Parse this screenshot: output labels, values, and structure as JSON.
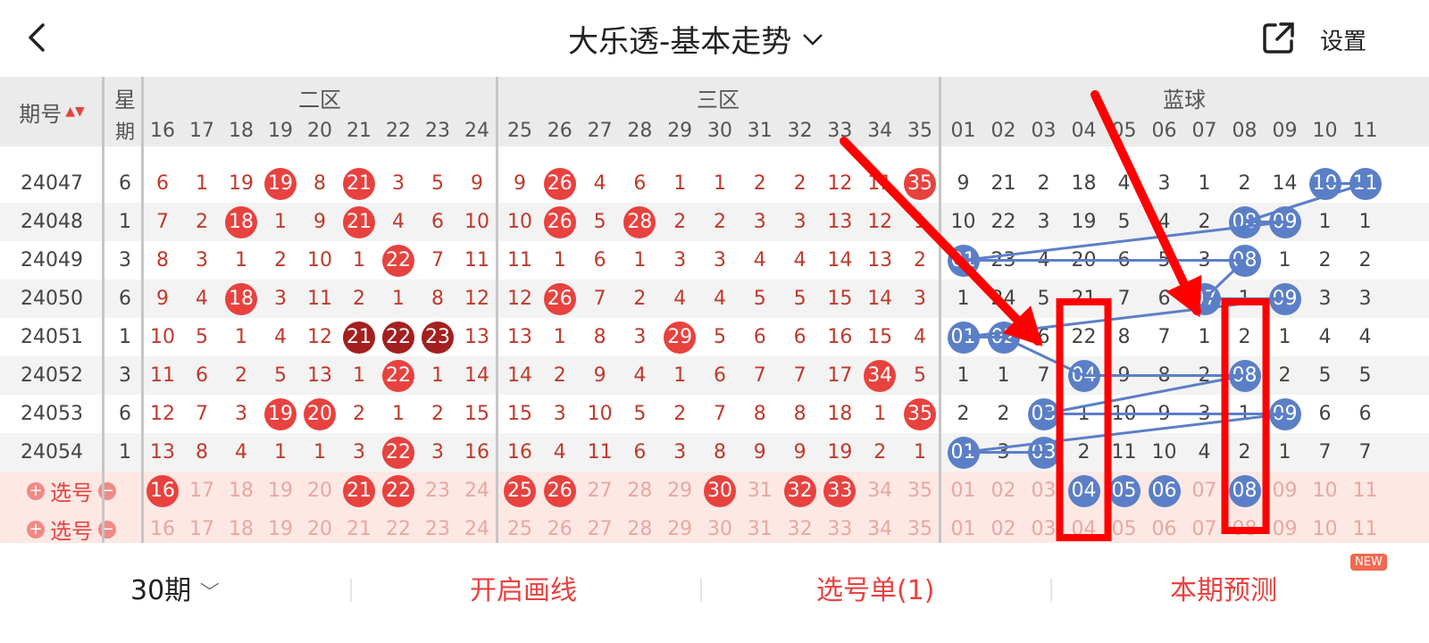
{
  "header": {
    "title": "大乐透-基本走势",
    "settings_label": "设置"
  },
  "table": {
    "issue_header": "期号",
    "week_header": [
      "星",
      "期"
    ],
    "zones": [
      "二区",
      "三区",
      "蓝球"
    ],
    "front_numbers": [
      "16",
      "17",
      "18",
      "19",
      "20",
      "21",
      "22",
      "23",
      "24",
      "25",
      "26",
      "27",
      "28",
      "29",
      "30",
      "31",
      "32",
      "33",
      "34",
      "35"
    ],
    "blue_numbers": [
      "01",
      "02",
      "03",
      "04",
      "05",
      "06",
      "07",
      "08",
      "09",
      "10",
      "11"
    ],
    "rows": [
      {
        "issue": "24047",
        "week": "6",
        "cells": [
          "6",
          "1",
          "19",
          "19",
          "8",
          "21",
          "3",
          "5",
          "9",
          "9",
          "26",
          "4",
          "6",
          "1",
          "1",
          "2",
          "2",
          "12",
          "11",
          "35"
        ],
        "blue": [
          "9",
          "21",
          "2",
          "18",
          "4",
          "3",
          "1",
          "2",
          "14",
          "10",
          "11"
        ]
      },
      {
        "issue": "24048",
        "week": "1",
        "cells": [
          "7",
          "2",
          "18",
          "1",
          "9",
          "21",
          "4",
          "6",
          "10",
          "10",
          "26",
          "5",
          "28",
          "2",
          "2",
          "3",
          "3",
          "13",
          "12",
          "1"
        ],
        "blue": [
          "10",
          "22",
          "3",
          "19",
          "5",
          "4",
          "2",
          "08",
          "09",
          "1",
          "1"
        ]
      },
      {
        "issue": "24049",
        "week": "3",
        "cells": [
          "8",
          "3",
          "1",
          "2",
          "10",
          "1",
          "22",
          "7",
          "11",
          "11",
          "1",
          "6",
          "1",
          "3",
          "3",
          "4",
          "4",
          "14",
          "13",
          "2"
        ],
        "blue": [
          "01",
          "23",
          "4",
          "20",
          "6",
          "5",
          "3",
          "08",
          "1",
          "2",
          "2"
        ]
      },
      {
        "issue": "24050",
        "week": "6",
        "cells": [
          "9",
          "4",
          "18",
          "3",
          "11",
          "2",
          "1",
          "8",
          "12",
          "12",
          "26",
          "7",
          "2",
          "4",
          "4",
          "5",
          "5",
          "15",
          "14",
          "3"
        ],
        "blue": [
          "1",
          "24",
          "5",
          "21",
          "7",
          "6",
          "07",
          "1",
          "09",
          "3",
          "3"
        ]
      },
      {
        "issue": "24051",
        "week": "1",
        "cells": [
          "10",
          "5",
          "1",
          "4",
          "12",
          "21",
          "22",
          "23",
          "13",
          "13",
          "1",
          "8",
          "3",
          "29",
          "5",
          "6",
          "6",
          "16",
          "15",
          "4"
        ],
        "blue": [
          "01",
          "02",
          "6",
          "22",
          "8",
          "7",
          "1",
          "2",
          "1",
          "4",
          "4"
        ]
      },
      {
        "issue": "24052",
        "week": "3",
        "cells": [
          "11",
          "6",
          "2",
          "5",
          "13",
          "1",
          "22",
          "1",
          "14",
          "14",
          "2",
          "9",
          "4",
          "1",
          "6",
          "7",
          "7",
          "17",
          "34",
          "5"
        ],
        "blue": [
          "1",
          "1",
          "7",
          "04",
          "9",
          "8",
          "2",
          "08",
          "2",
          "5",
          "5"
        ]
      },
      {
        "issue": "24053",
        "week": "6",
        "cells": [
          "12",
          "7",
          "3",
          "19",
          "20",
          "2",
          "1",
          "2",
          "15",
          "15",
          "3",
          "10",
          "5",
          "2",
          "7",
          "8",
          "8",
          "18",
          "1",
          "35"
        ],
        "blue": [
          "2",
          "2",
          "03",
          "1",
          "10",
          "9",
          "3",
          "1",
          "09",
          "6",
          "6"
        ]
      },
      {
        "issue": "24054",
        "week": "1",
        "cells": [
          "13",
          "8",
          "4",
          "1",
          "1",
          "3",
          "22",
          "3",
          "16",
          "16",
          "4",
          "11",
          "6",
          "3",
          "8",
          "9",
          "9",
          "19",
          "2",
          "1"
        ],
        "blue": [
          "01",
          "3",
          "03",
          "2",
          "11",
          "10",
          "4",
          "2",
          "1",
          "7",
          "7"
        ]
      }
    ],
    "select_label": "选号",
    "select_rows": [
      {
        "front": [
          "16",
          "17",
          "18",
          "19",
          "20",
          "21",
          "22",
          "23",
          "24",
          "25",
          "26",
          "27",
          "28",
          "29",
          "30",
          "31",
          "32",
          "33",
          "34",
          "35"
        ],
        "blue": [
          "01",
          "02",
          "03",
          "04",
          "05",
          "06",
          "07",
          "08",
          "09",
          "10",
          "11"
        ]
      },
      {
        "front": [
          "16",
          "17",
          "18",
          "19",
          "20",
          "21",
          "22",
          "23",
          "24",
          "25",
          "26",
          "27",
          "28",
          "29",
          "30",
          "31",
          "32",
          "33",
          "34",
          "35"
        ],
        "blue": [
          "01",
          "02",
          "03",
          "04",
          "05",
          "06",
          "07",
          "08",
          "09",
          "10",
          "11"
        ]
      }
    ]
  },
  "bottom": {
    "period": "30期",
    "draw_lines": "开启画线",
    "pick_list": "选号单(1)",
    "predict": "本期预测",
    "new_badge": "NEW"
  }
}
